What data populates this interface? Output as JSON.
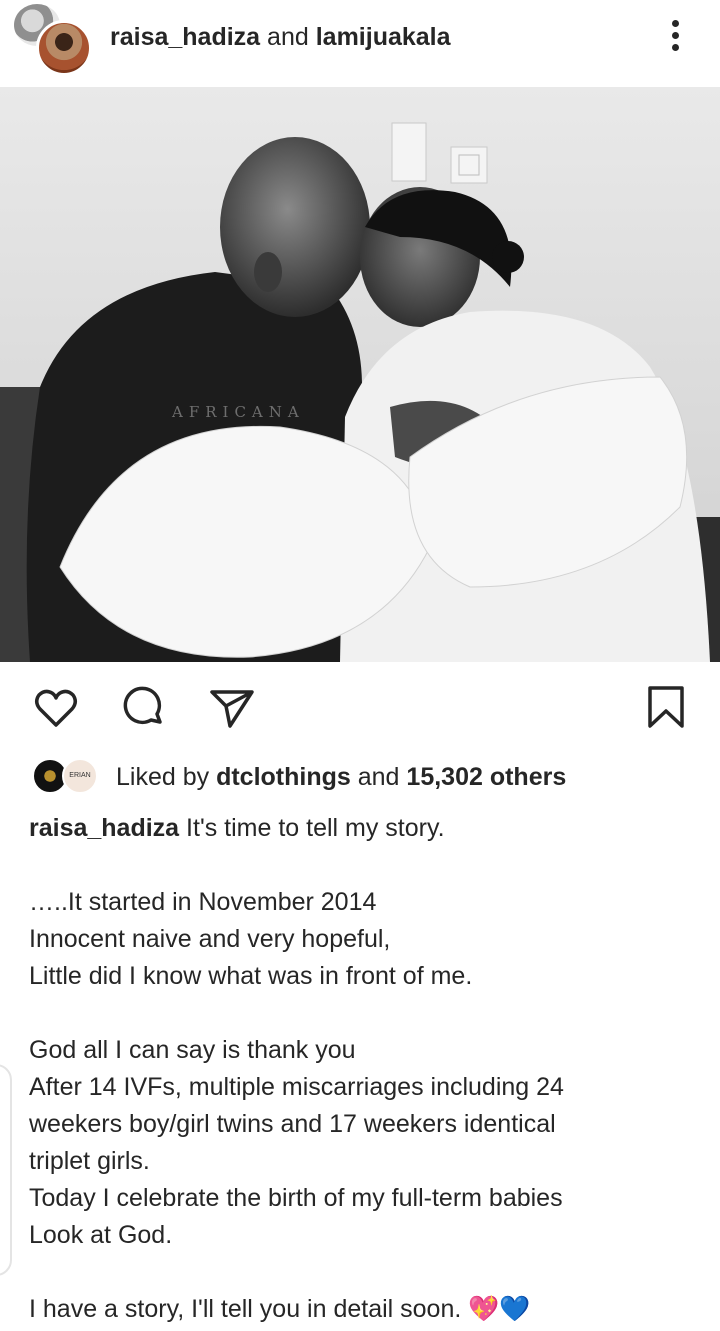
{
  "post": {
    "header": {
      "account_1": "raisa_hadiza",
      "joiner": "and",
      "account_2": "lamijuakala",
      "more_icon": "more-vertical-icon"
    },
    "photo": {
      "print_text": "AFRICANA"
    },
    "actions": {
      "like_icon": "heart-icon",
      "comment_icon": "comment-icon",
      "share_icon": "send-icon",
      "save_icon": "bookmark-icon"
    },
    "likes": {
      "prefix": "Liked by",
      "first_liker": "dtclothings",
      "joiner": "and",
      "others": "15,302 others",
      "second_avatar_text": "ERIAN"
    },
    "caption": {
      "username": "raisa_hadiza",
      "first_line": "It's time to tell my story.",
      "lines": [
        "…..It started in November 2014",
        "Innocent naive and very hopeful,",
        "Little did I know what was in front of me.",
        "",
        "God all I can say is thank you",
        "After 14 IVFs, multiple miscarriages including 24",
        "weekers boy/girl twins and 17 weekers identical",
        "triplet girls.",
        "Today I celebrate the birth of my full-term babies",
        "Look at God.",
        "",
        "I have a story, I'll tell you in detail soon. 💖💙"
      ]
    }
  }
}
